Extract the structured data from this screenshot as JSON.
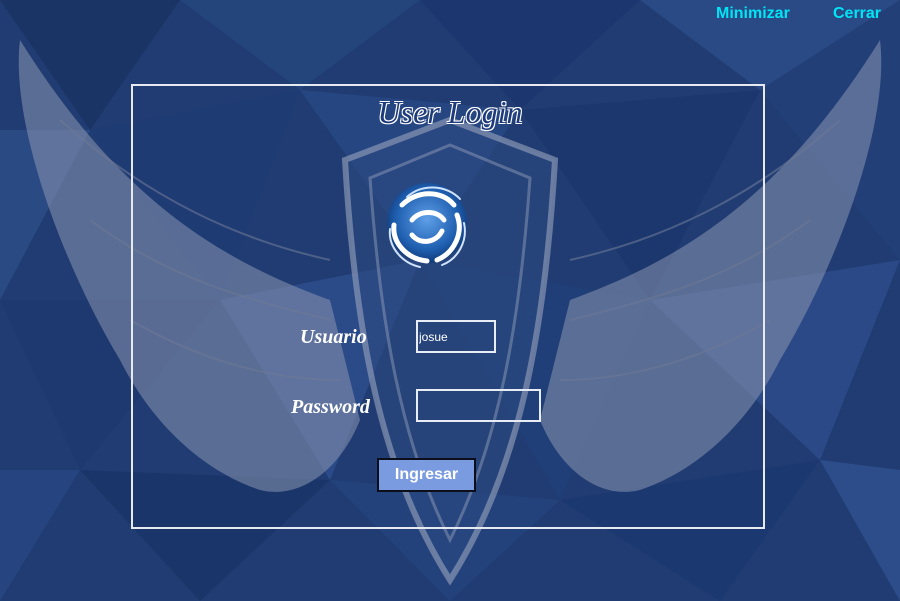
{
  "window": {
    "minimize_label": "Minimizar",
    "close_label": "Cerrar"
  },
  "login": {
    "title": "User Login",
    "username_label": "Usuario",
    "username_value": "josue",
    "password_label": "Password",
    "password_value": "",
    "submit_label": "Ingresar"
  },
  "colors": {
    "background": "#1f3a6e",
    "top_buttons": "#00e5f5",
    "submit_button": "#7b9be0",
    "panel_border": "#e6e9f0"
  },
  "icons": {
    "background_art": "angel-wings-shield",
    "logo": "swirl-logo-icon"
  }
}
